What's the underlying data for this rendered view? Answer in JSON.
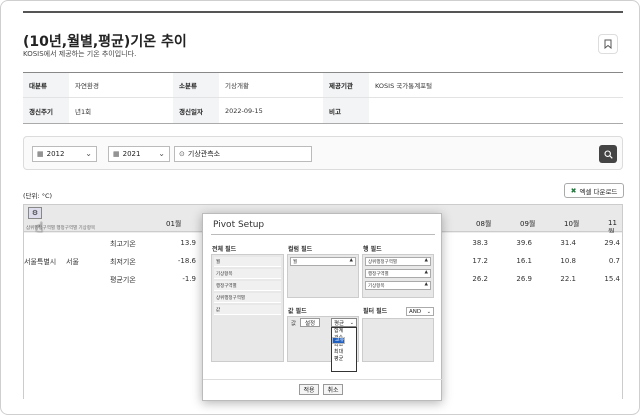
{
  "page": {
    "title": "(10년,월별,평균)기온 추이",
    "subtitle": "KOSIS에서 제공하는 기온 추이입니다."
  },
  "meta": {
    "row1": [
      {
        "key": "대분류",
        "value": "자연환경"
      },
      {
        "key": "소분류",
        "value": "기상개황"
      },
      {
        "key": "제공기관",
        "value": "KOSIS 국가통계포털"
      }
    ],
    "row2": [
      {
        "key": "갱신주기",
        "value": "년1회"
      },
      {
        "key": "갱신일자",
        "value": "2022-09-15"
      },
      {
        "key": "비고",
        "value": ""
      }
    ]
  },
  "filters": {
    "start_year": "2012",
    "end_year": "2021",
    "tilde": "~",
    "location": "기상관측소"
  },
  "unit_label": "(단위: °C)",
  "excel_button": "엑셀 다운로드",
  "grid": {
    "first_col_header": "01월",
    "months_visible": [
      "08월",
      "09월",
      "10월",
      "11월"
    ],
    "field_hints": "삼위행정구역별  행정구역별  기상항목",
    "region1": "서울특별시",
    "region2": "서울",
    "rows": [
      {
        "label": "최고기온",
        "jan": "13.9",
        "aug": "38.3",
        "sep": "39.6",
        "oct": "31.4",
        "nov": "29.4"
      },
      {
        "label": "최저기온",
        "jan": "-18.6",
        "aug": "17.2",
        "sep": "16.1",
        "oct": "10.8",
        "nov": "0.7"
      },
      {
        "label": "평균기온",
        "jan": "-1.9",
        "aug": "26.2",
        "sep": "26.9",
        "oct": "22.1",
        "nov": "15.4"
      }
    ]
  },
  "pivot": {
    "title": "Pivot Setup",
    "all_fields_label": "전체 필드",
    "all_fields": [
      "월",
      "기상항목",
      "행정구역별",
      "상위행정구역별",
      "값"
    ],
    "column_fields_label": "컬럼 필드",
    "column_fields": [
      "월"
    ],
    "row_fields_label": "행 필드",
    "row_fields": [
      "상위행정구역별",
      "행정구역별",
      "기상항목"
    ],
    "value_fields_label": "값 필드",
    "value_item": "값",
    "set_button": "설정",
    "aggregate_selected": "평균",
    "aggregate_options": [
      "합계",
      "건수",
      "최소",
      "최대",
      "평균",
      "고유"
    ],
    "aggregate_highlight": "고유",
    "filter_fields_label": "필터 필드",
    "filter_mode": "AND",
    "apply_button": "적용",
    "cancel_button": "취소"
  }
}
